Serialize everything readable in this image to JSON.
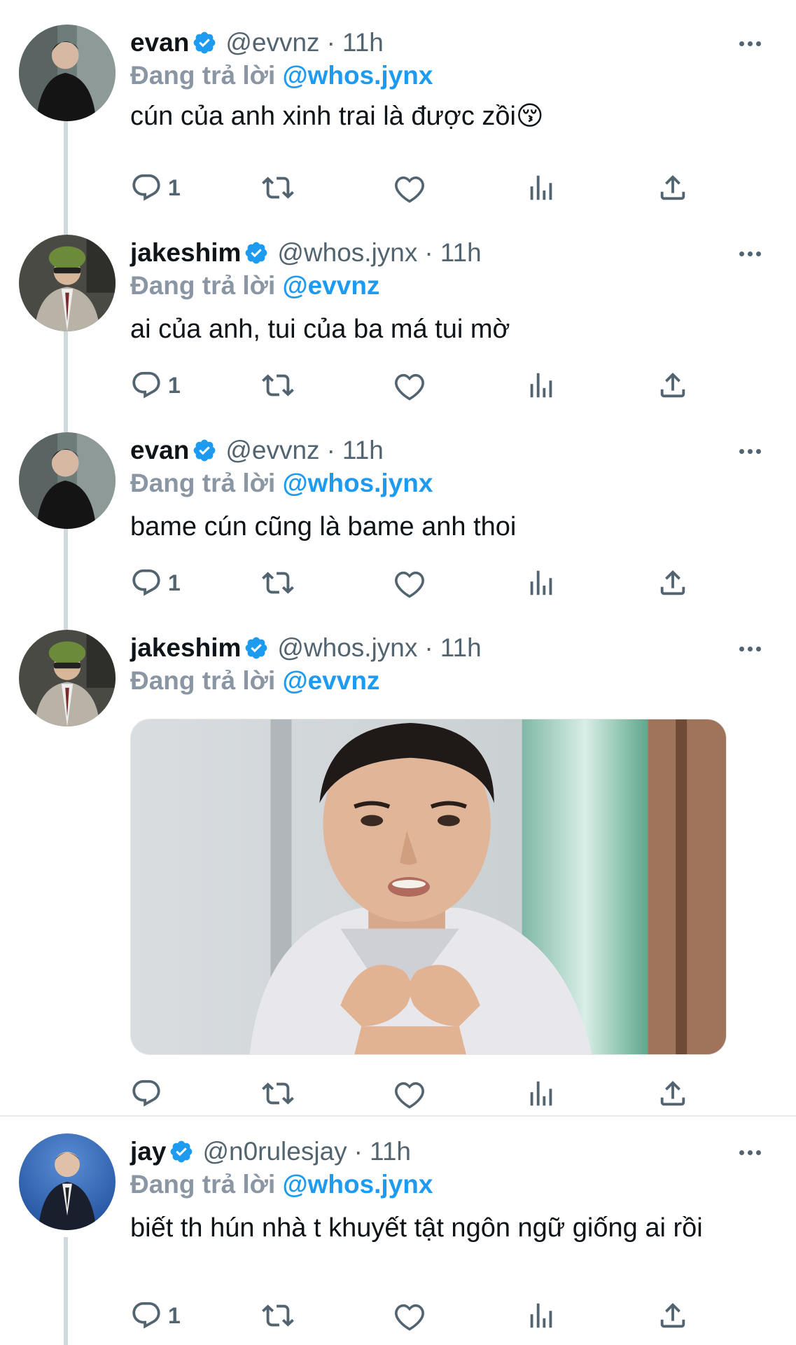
{
  "colors": {
    "accent": "#1d9bf0",
    "secondary_text": "#536471",
    "replying_text": "#8a96a3",
    "thread_line": "#cfd9de"
  },
  "tweets": [
    {
      "name": "evan",
      "handle": "@evvnz",
      "separator": "·",
      "time": "11h",
      "replying_prefix": "Đang trả lời",
      "replying_to": "@whos.jynx",
      "text": "cún của anh xinh trai là được zồi😚",
      "reply_count": "1",
      "avatar_icon": "avatar-photo"
    },
    {
      "name": "jakeshim",
      "handle": "@whos.jynx",
      "separator": "·",
      "time": "11h",
      "replying_prefix": "Đang trả lời",
      "replying_to": "@evvnz",
      "text": "ai của anh, tui của ba má tui mờ",
      "reply_count": "1",
      "avatar_icon": "avatar-photo"
    },
    {
      "name": "evan",
      "handle": "@evvnz",
      "separator": "·",
      "time": "11h",
      "replying_prefix": "Đang trả lời",
      "replying_to": "@whos.jynx",
      "text": "bame cún cũng là bame anh thoi",
      "reply_count": "1",
      "avatar_icon": "avatar-photo"
    },
    {
      "name": "jakeshim",
      "handle": "@whos.jynx",
      "separator": "·",
      "time": "11h",
      "replying_prefix": "Đang trả lời",
      "replying_to": "@evvnz",
      "text": "",
      "reply_count": "",
      "avatar_icon": "avatar-photo",
      "media": "heart-hands-photo"
    },
    {
      "name": "jay",
      "handle": "@n0rulesjay",
      "separator": "·",
      "time": "11h",
      "replying_prefix": "Đang trả lời",
      "replying_to": "@whos.jynx",
      "text": "biết th hún nhà t khuyết tật ngôn ngữ giống ai rồi",
      "reply_count": "1",
      "avatar_icon": "avatar-photo"
    }
  ],
  "icons": {
    "verified": "verified-badge-icon",
    "reply": "reply-icon",
    "retweet": "retweet-icon",
    "like": "like-icon",
    "views": "views-icon",
    "share": "share-icon",
    "more": "more-icon"
  }
}
